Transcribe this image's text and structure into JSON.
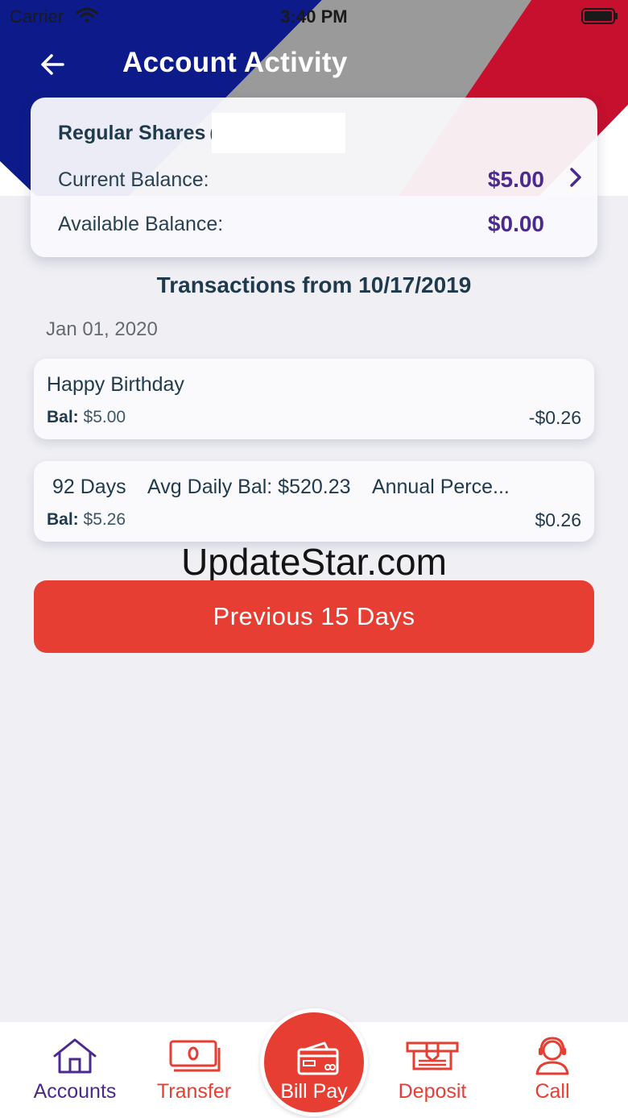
{
  "status_bar": {
    "carrier": "Carrier",
    "time": "3:40 PM"
  },
  "header": {
    "title": "Account Activity",
    "colors": {
      "blue": "#0d1a8a",
      "gray": "#9a9a9a",
      "red": "#c6102e"
    }
  },
  "account": {
    "name": "Regular Shares",
    "paren": "(",
    "current_balance_label": "Current Balance:",
    "current_balance": "$5.00",
    "available_balance_label": "Available Balance:",
    "available_balance": "$0.00"
  },
  "transactions": {
    "title": "Transactions from 10/17/2019",
    "groups": [
      {
        "date": "Jan 01, 2020",
        "items": [
          {
            "description": "Happy Birthday",
            "bal_label": "Bal:",
            "balance": "$5.00",
            "amount": "-$0.26"
          },
          {
            "description": " 92 Days    Avg Daily Bal: $520.23    Annual Perce...",
            "bal_label": "Bal:",
            "balance": "$5.26",
            "amount": "$0.26"
          }
        ]
      }
    ]
  },
  "watermark": "UpdateStar.com",
  "previous_button": "Previous 15 Days",
  "tab_bar": {
    "items": [
      {
        "label": "Accounts",
        "icon": "home-icon",
        "color": "#4b2a8f"
      },
      {
        "label": "Transfer",
        "icon": "cash-icon",
        "color": "#e73e33"
      },
      {
        "label": "Bill Pay",
        "icon": "wallet-icon",
        "color": "#ffffff"
      },
      {
        "label": "Deposit",
        "icon": "atm-deposit-icon",
        "color": "#e73e33"
      },
      {
        "label": "Call",
        "icon": "headset-icon",
        "color": "#e73e33"
      }
    ]
  },
  "colors": {
    "accent_red": "#e73e33",
    "accent_purple": "#4b2a8f",
    "text_dark": "#1f3a4d",
    "background": "#efeff4"
  }
}
